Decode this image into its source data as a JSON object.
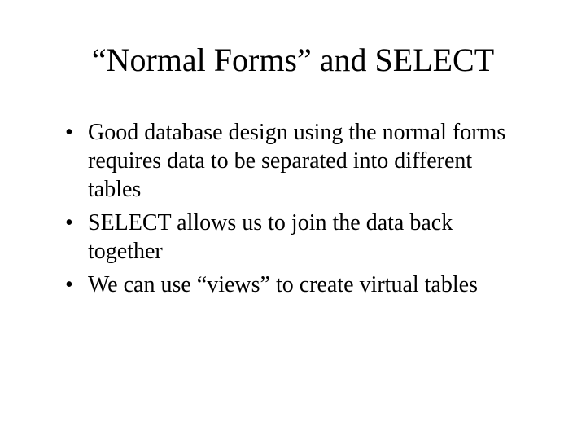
{
  "slide": {
    "title": "“Normal Forms” and SELECT",
    "bullets": [
      "Good database design using the normal forms requires data to be separated into different tables",
      "SELECT allows us to join the data back together",
      "We can use “views” to create virtual tables"
    ]
  }
}
